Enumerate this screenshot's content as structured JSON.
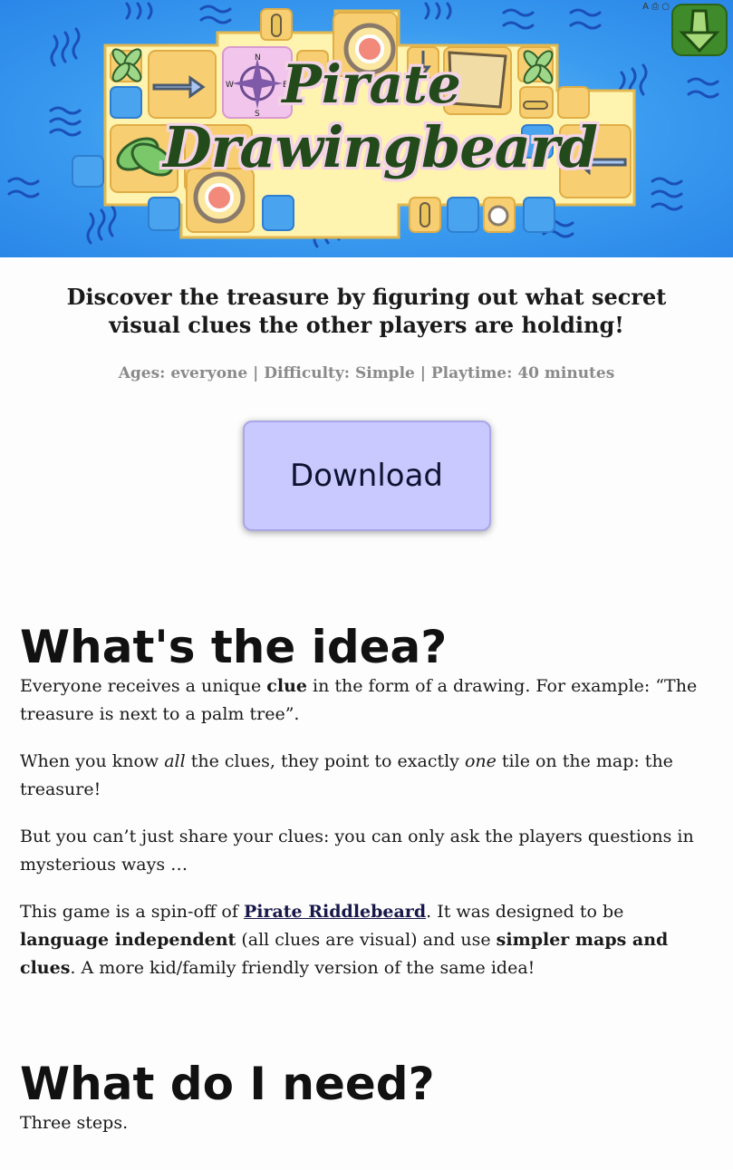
{
  "hero": {
    "title_line1": "Pirate",
    "title_line2": "Drawingbeard",
    "compass": {
      "n": "N",
      "s": "S",
      "e": "E",
      "w": "W"
    },
    "status_icons": "A ⎙ ○"
  },
  "colors": {
    "ocean": "#3a9bef",
    "tile": "#f7cf72",
    "title": "#234a1a",
    "download_bg": "#c9c8ff",
    "meta_text": "#8a8a8a"
  },
  "tagline": "Discover the treasure by figuring out what secret visual clues the other players are holding!",
  "meta": {
    "ages": "Ages: everyone",
    "difficulty": "Difficulty: Simple",
    "playtime": "Playtime: 40 minutes",
    "separator": "|"
  },
  "download_label": "Download",
  "idea": {
    "heading": "What's the idea?",
    "p1_a": "Everyone receives a unique ",
    "p1_b": "clue",
    "p1_c": " in the form of a drawing. For example: “The treasure is next to a palm tree”.",
    "p2_a": "When you know ",
    "p2_b": "all",
    "p2_c": " the clues, they point to exactly ",
    "p2_d": "one",
    "p2_e": " tile on the map: the treasure!",
    "p3": "But you can’t just share your clues: you can only ask the players questions in mysterious ways …",
    "p4_a": "This game is a spin-off of ",
    "p4_link": "Pirate Riddlebeard",
    "p4_b": ". It was designed to be ",
    "p4_c": "language independent",
    "p4_d": " (all clues are visual) and use ",
    "p4_e": "simpler maps and clues",
    "p4_f": ". A more kid/family friendly version of the same idea!"
  },
  "need": {
    "heading": "What do I need?",
    "p1": "Three steps."
  }
}
